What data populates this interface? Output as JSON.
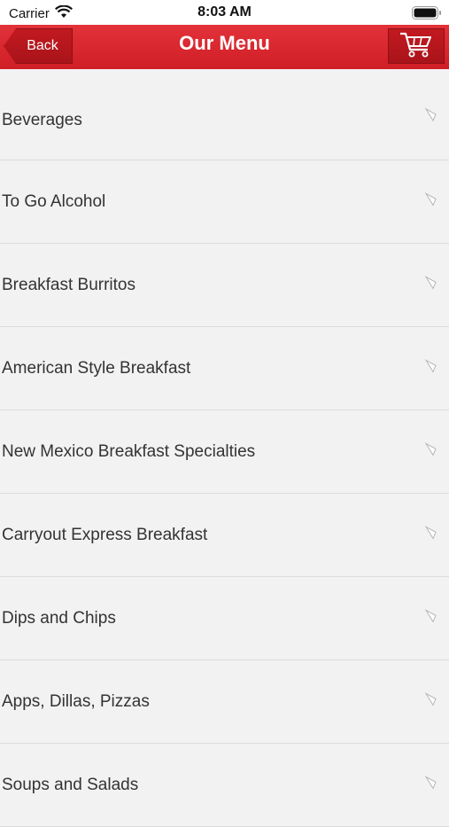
{
  "status_bar": {
    "carrier": "Carrier",
    "time": "8:03 AM"
  },
  "navbar": {
    "back_label": "Back",
    "title": "Our Menu",
    "cart_icon": "cart-icon"
  },
  "menu": {
    "items": [
      {
        "label": "Beverages"
      },
      {
        "label": "To Go Alcohol"
      },
      {
        "label": "Breakfast Burritos"
      },
      {
        "label": "American Style Breakfast"
      },
      {
        "label": "New Mexico Breakfast Specialties"
      },
      {
        "label": "Carryout Express Breakfast"
      },
      {
        "label": "Dips and Chips"
      },
      {
        "label": "Apps, Dillas, Pizzas"
      },
      {
        "label": "Soups and Salads"
      }
    ]
  },
  "colors": {
    "brand_red": "#d9262d",
    "background": "#f2f2f2",
    "text": "#333333"
  }
}
